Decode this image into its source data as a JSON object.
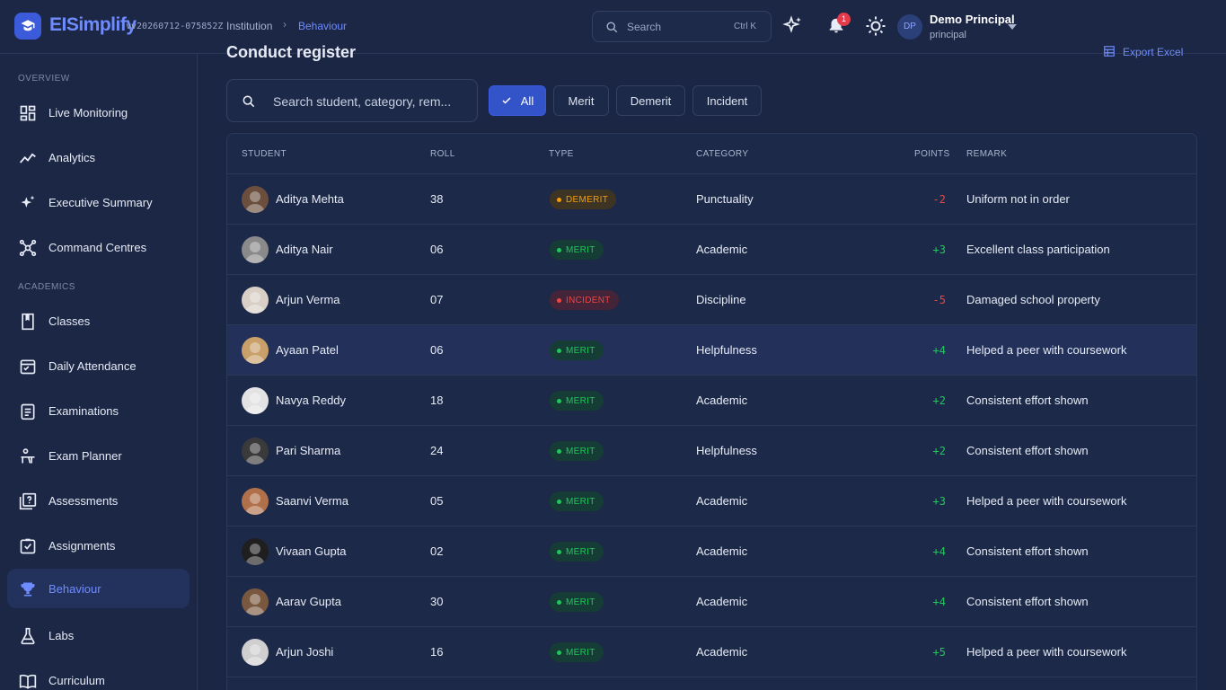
{
  "header": {
    "brand": "EISimplify",
    "version": "vv20260712-075852Z",
    "breadcrumb": [
      "Institution",
      "Behaviour"
    ],
    "search_placeholder": "Search",
    "search_shortcut": "Ctrl K",
    "notification_count": "1",
    "user_initials": "DP",
    "user_name": "Demo Principal",
    "user_role": "principal"
  },
  "sidebar": {
    "sections": [
      {
        "label": "OVERVIEW",
        "items": [
          {
            "label": "Live Monitoring",
            "icon": "dashboard-icon"
          },
          {
            "label": "Analytics",
            "icon": "chart-line-icon"
          },
          {
            "label": "Executive Summary",
            "icon": "sparkles-icon"
          },
          {
            "label": "Command Centres",
            "icon": "hub-icon"
          }
        ]
      },
      {
        "label": "ACADEMICS",
        "items": [
          {
            "label": "Classes",
            "icon": "book-icon"
          },
          {
            "label": "Daily Attendance",
            "icon": "calendar-check-icon"
          },
          {
            "label": "Examinations",
            "icon": "clipboard-icon"
          },
          {
            "label": "Exam Planner",
            "icon": "desk-icon"
          },
          {
            "label": "Assessments",
            "icon": "quiz-icon"
          },
          {
            "label": "Assignments",
            "icon": "checkbox-icon"
          },
          {
            "label": "Behaviour",
            "icon": "trophy-icon",
            "active": true
          },
          {
            "label": "Labs",
            "icon": "flask-icon"
          },
          {
            "label": "Curriculum",
            "icon": "open-book-icon"
          }
        ]
      }
    ]
  },
  "main": {
    "title": "Conduct register",
    "export_label": "Export Excel",
    "search_placeholder": "Search student, category, rem...",
    "filters": [
      "All",
      "Merit",
      "Demerit",
      "Incident"
    ],
    "selected_filter": "All",
    "columns": [
      "STUDENT",
      "ROLL",
      "TYPE",
      "CATEGORY",
      "POINTS",
      "REMARK"
    ],
    "rows": [
      {
        "student": "Aditya Mehta",
        "roll": "38",
        "type": "DEMERIT",
        "category": "Punctuality",
        "points": "-2",
        "remark": "Uniform not in order"
      },
      {
        "student": "Aditya Nair",
        "roll": "06",
        "type": "MERIT",
        "category": "Academic",
        "points": "+3",
        "remark": "Excellent class participation"
      },
      {
        "student": "Arjun Verma",
        "roll": "07",
        "type": "INCIDENT",
        "category": "Discipline",
        "points": "-5",
        "remark": "Damaged school property"
      },
      {
        "student": "Ayaan Patel",
        "roll": "06",
        "type": "MERIT",
        "category": "Helpfulness",
        "points": "+4",
        "remark": "Helped a peer with coursework"
      },
      {
        "student": "Navya Reddy",
        "roll": "18",
        "type": "MERIT",
        "category": "Academic",
        "points": "+2",
        "remark": "Consistent effort shown"
      },
      {
        "student": "Pari Sharma",
        "roll": "24",
        "type": "MERIT",
        "category": "Helpfulness",
        "points": "+2",
        "remark": "Consistent effort shown"
      },
      {
        "student": "Saanvi Verma",
        "roll": "05",
        "type": "MERIT",
        "category": "Academic",
        "points": "+3",
        "remark": "Helped a peer with coursework"
      },
      {
        "student": "Vivaan Gupta",
        "roll": "02",
        "type": "MERIT",
        "category": "Academic",
        "points": "+4",
        "remark": "Consistent effort shown"
      },
      {
        "student": "Aarav Gupta",
        "roll": "30",
        "type": "MERIT",
        "category": "Academic",
        "points": "+4",
        "remark": "Consistent effort shown"
      },
      {
        "student": "Arjun Joshi",
        "roll": "16",
        "type": "MERIT",
        "category": "Academic",
        "points": "+5",
        "remark": "Helped a peer with coursework"
      }
    ]
  },
  "colors": {
    "accent": "#6f8cff",
    "merit": "#22c55e",
    "demerit": "#f59e0b",
    "incident": "#ef4444",
    "background": "#1b2645"
  }
}
